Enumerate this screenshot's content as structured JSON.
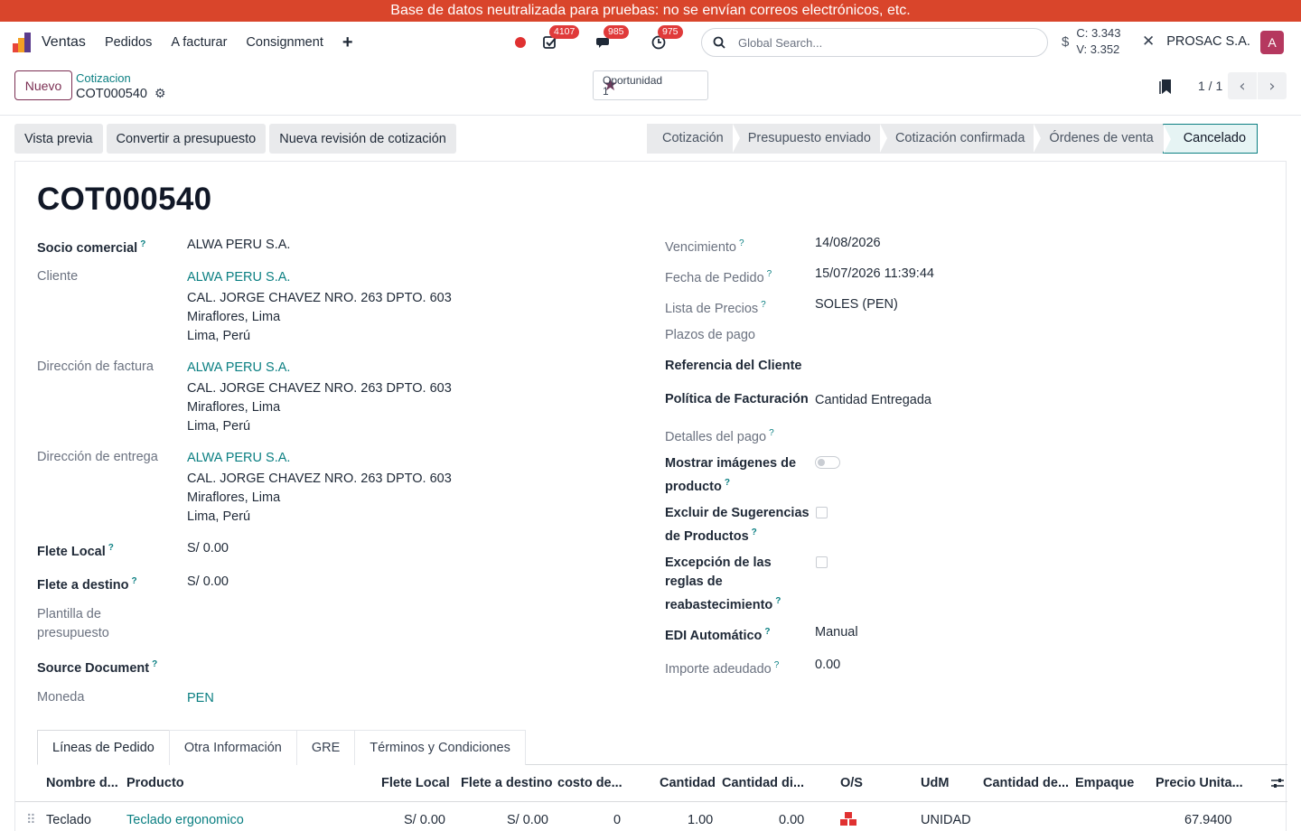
{
  "banner": "Base de datos neutralizada para pruebas: no se envían correos electrónicos, etc.",
  "navbar": {
    "app_name": "Ventas",
    "menu": [
      "Pedidos",
      "A facturar",
      "Consignment"
    ],
    "plus": "+",
    "activities_count": "4107",
    "messages_count": "985",
    "clock_count": "975",
    "search_placeholder": "Global Search...",
    "currency_symbol": "$",
    "rate_buy": "C: 3.343",
    "rate_sell": "V: 3.352",
    "company": "PROSAC S.A.",
    "avatar_letter": "A",
    "colors": {
      "accent": "#7b2f53",
      "link": "#0b7f82",
      "avatar": "#b5385f",
      "badge": "#e03a3a"
    }
  },
  "control": {
    "new_button": "Nuevo",
    "breadcrumb_parent": "Cotizacion",
    "breadcrumb_current": "COT000540",
    "smart_button_label": "Oportunidad",
    "smart_button_count": "1",
    "pager": "1 / 1"
  },
  "actions": [
    "Vista previa",
    "Convertir a presupuesto",
    "Nueva revisión de cotización"
  ],
  "status_stages": [
    "Cotización",
    "Presupuesto enviado",
    "Cotización confirmada",
    "Órdenes de venta",
    "Cancelado"
  ],
  "status_active": "Cancelado",
  "record": {
    "title": "COT000540",
    "socio_comercial": {
      "label": "Socio comercial",
      "value": "ALWA PERU S.A."
    },
    "cliente": {
      "label": "Cliente",
      "name": "ALWA PERU S.A.",
      "line1": "CAL. JORGE CHAVEZ NRO. 263 DPTO. 603",
      "line2": "Miraflores, Lima",
      "line3": "Lima, Perú"
    },
    "direccion_factura": {
      "label": "Dirección de factura",
      "name": "ALWA PERU S.A.",
      "line1": "CAL. JORGE CHAVEZ NRO. 263 DPTO. 603",
      "line2": "Miraflores, Lima",
      "line3": "Lima, Perú"
    },
    "direccion_entrega": {
      "label": "Dirección de entrega",
      "name": "ALWA PERU S.A.",
      "line1": "CAL. JORGE CHAVEZ NRO. 263 DPTO. 603",
      "line2": "Miraflores, Lima",
      "line3": "Lima, Perú"
    },
    "flete_local": {
      "label": "Flete Local",
      "value": "S/ 0.00"
    },
    "flete_destino": {
      "label": "Flete a destino",
      "value": "S/ 0.00"
    },
    "plantilla": {
      "label_1": "Plantilla de",
      "label_2": "presupuesto"
    },
    "source_document": {
      "label": "Source Document"
    },
    "moneda": {
      "label": "Moneda",
      "value": "PEN"
    },
    "vencimiento": {
      "label": "Vencimiento",
      "value": "14/08/2026"
    },
    "fecha_pedido": {
      "label": "Fecha de Pedido",
      "value": "15/07/2026 11:39:44"
    },
    "lista_precios": {
      "label": "Lista de Precios",
      "value": "SOLES (PEN)"
    },
    "plazos_pago": {
      "label": "Plazos de pago"
    },
    "referencia_cliente": {
      "label": "Referencia del Cliente"
    },
    "politica_facturacion": {
      "label": "Política de Facturación",
      "value": "Cantidad Entregada"
    },
    "detalles_pago": {
      "label": "Detalles del pago"
    },
    "mostrar_imagenes": {
      "label_1": "Mostrar imágenes de",
      "label_2": "producto",
      "checked": false
    },
    "excluir_sugerencias": {
      "label_1": "Excluir de Sugerencias",
      "label_2": "de Productos",
      "checked": false
    },
    "excepcion_reglas": {
      "label_1": "Excepción de las",
      "label_2": "reglas de",
      "label_3": "reabastecimiento",
      "checked": false
    },
    "edi_automatico": {
      "label": "EDI Automático",
      "value": "Manual"
    },
    "importe_adeudado": {
      "label": "Importe adeudado",
      "value": "0.00"
    }
  },
  "tabs": [
    "Líneas de Pedido",
    "Otra Información",
    "GRE",
    "Términos y Condiciones"
  ],
  "order_lines": {
    "columns": [
      "Nombre d...",
      "Producto",
      "Flete Local",
      "Flete a destino",
      "costo de...",
      "Cantidad",
      "Cantidad di...",
      "O/S",
      "UdM",
      "Cantidad de...",
      "Empaque",
      "Precio Unita..."
    ],
    "rows": [
      {
        "name": "Teclado",
        "product": "Teclado ergonomico",
        "flete_local": "S/ 0.00",
        "flete_destino": "S/ 0.00",
        "costo": "0",
        "cantidad": "1.00",
        "cantidad_disp": "0.00",
        "uom": "UNIDAD",
        "precio": "67.9400"
      }
    ]
  }
}
